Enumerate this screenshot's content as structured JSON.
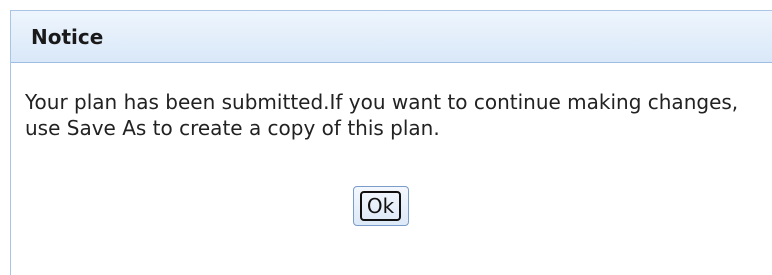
{
  "dialog": {
    "title": "Notice",
    "message": "Your plan has been submitted.If you want to continue making changes, use Save As to create a copy of this plan.",
    "ok_label": "Ok"
  },
  "colors": {
    "titlebar_top": "#eef5fd",
    "titlebar_bottom": "#d9e8f8",
    "border": "#a9c4e4"
  }
}
